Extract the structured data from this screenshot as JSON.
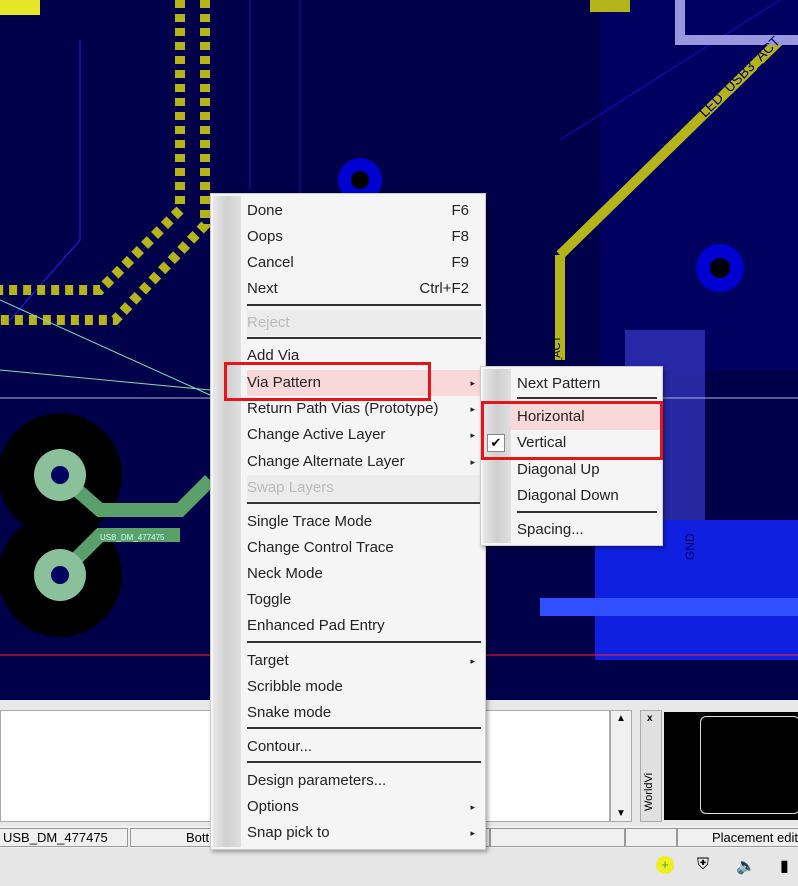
{
  "pcb": {
    "labels": [
      "LED_USB3_ACT",
      "USB_DM_477475",
      "3_ACT",
      "GND"
    ],
    "colors": {
      "board": "#000060",
      "trace": "#b5b41a",
      "selected": "#5aa06a",
      "via": "#0000d0"
    }
  },
  "menu": {
    "items": [
      {
        "label": "Done",
        "shortcut": "F6"
      },
      {
        "label": "Oops",
        "shortcut": "F8"
      },
      {
        "label": "Cancel",
        "shortcut": "F9"
      },
      {
        "label": "Next",
        "shortcut": "Ctrl+F2"
      },
      {
        "label": "Reject",
        "disabled": true
      },
      {
        "label": "Add Via"
      },
      {
        "label": "Via Pattern",
        "submenu": true,
        "highlighted": true
      },
      {
        "label": "Return Path Vias (Prototype)",
        "submenu": true
      },
      {
        "label": "Change Active Layer",
        "submenu": true
      },
      {
        "label": "Change Alternate Layer",
        "submenu": true
      },
      {
        "label": "Swap Layers",
        "disabled": true
      },
      {
        "label": "Single Trace Mode"
      },
      {
        "label": "Change Control Trace"
      },
      {
        "label": "Neck Mode"
      },
      {
        "label": "Toggle"
      },
      {
        "label": "Enhanced Pad Entry"
      },
      {
        "label": "Target",
        "submenu": true
      },
      {
        "label": "Scribble mode"
      },
      {
        "label": "Snake mode"
      },
      {
        "label": "Contour..."
      },
      {
        "label": "Design parameters..."
      },
      {
        "label": "Options",
        "submenu": true
      },
      {
        "label": "Snap pick to",
        "submenu": true
      }
    ]
  },
  "submenu": {
    "items": [
      {
        "label": "Next Pattern"
      },
      {
        "label": "Horizontal",
        "highlighted": true
      },
      {
        "label": "Vertical",
        "checked": true
      },
      {
        "label": "Diagonal Up"
      },
      {
        "label": "Diagonal Down"
      },
      {
        "label": "Spacing..."
      }
    ]
  },
  "worldview": {
    "label": "WorldVi"
  },
  "status": {
    "net": "USB_DM_477475",
    "layer": "Bott",
    "mode": "Placement edit"
  },
  "icons": {
    "arrow": "▸",
    "check": "✔",
    "up": "▲",
    "down": "▼",
    "close": "x"
  }
}
